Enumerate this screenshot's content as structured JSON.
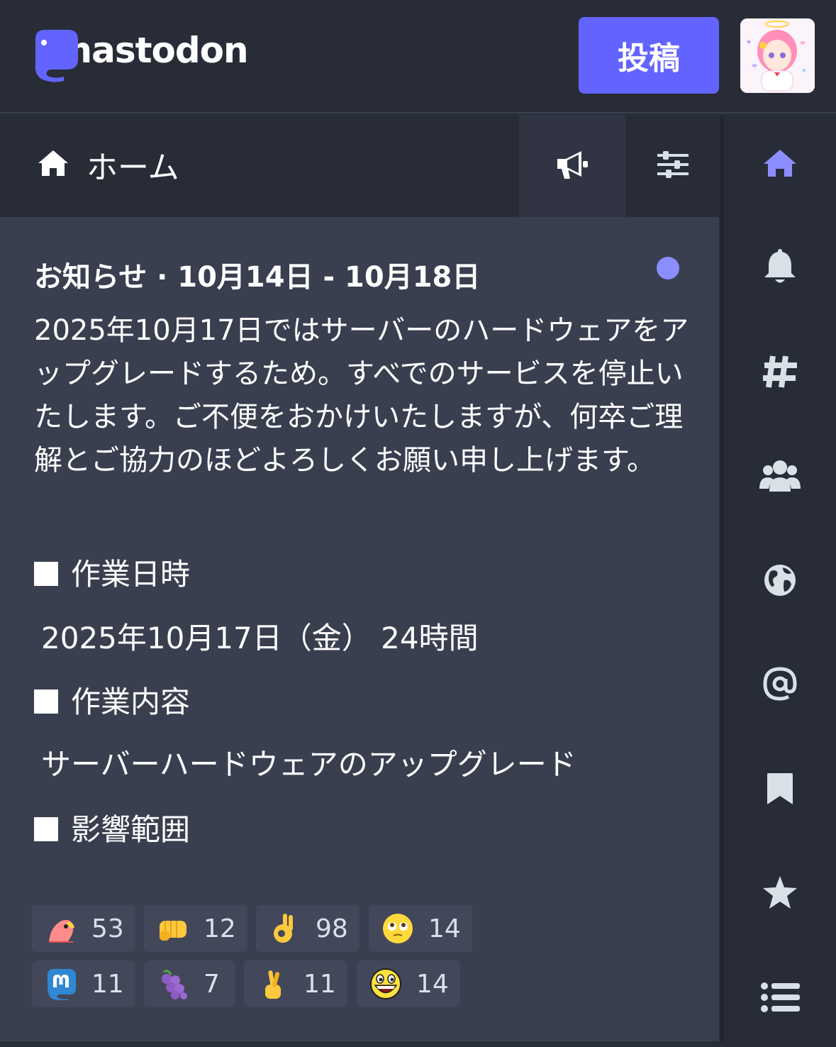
{
  "header": {
    "logo_text": "mastodon",
    "post_button": "投稿",
    "avatar_alt": "avatar"
  },
  "column": {
    "title": "ホーム",
    "icon": "home-icon",
    "buttons": [
      "bullhorn-icon",
      "sliders-icon"
    ]
  },
  "announcement": {
    "title": "お知らせ · 10月14日 - 10月18日",
    "unread": true,
    "body": "2025年10月17日ではサーバーのハードウェアをアップグレードするため。すべでのサービスを停止いたします。ご不便をおかけいたしますが、何卒ご理解とご協力のほどよろしくお願い申し上げます。",
    "sections": [
      {
        "heading": "作業日時",
        "content": "2025年10月17日（金） 24時間"
      },
      {
        "heading": "作業内容",
        "content": "サーバーハードウェアのアップグレード"
      },
      {
        "heading": "影響範囲"
      }
    ],
    "reactions": [
      {
        "emoji": "party-parrot",
        "count": "53"
      },
      {
        "emoji": "fist",
        "count": "12"
      },
      {
        "emoji": "ok-hand",
        "count": "98"
      },
      {
        "emoji": "pleading-face",
        "count": "14"
      },
      {
        "emoji": "mastodon",
        "count": "11"
      },
      {
        "emoji": "grapes",
        "count": "7"
      },
      {
        "emoji": "crossed-fingers",
        "count": "11"
      },
      {
        "emoji": "awesome-face",
        "count": "14"
      }
    ]
  },
  "nav": [
    "home-icon",
    "bell-icon",
    "hashtag-icon",
    "users-icon",
    "globe-icon",
    "at-icon",
    "bookmark-icon",
    "star-icon",
    "list-icon"
  ],
  "colors": {
    "accent": "#6364ff",
    "active_nav": "#8c8dff",
    "background": "#282c37",
    "panel": "#393f4f"
  }
}
